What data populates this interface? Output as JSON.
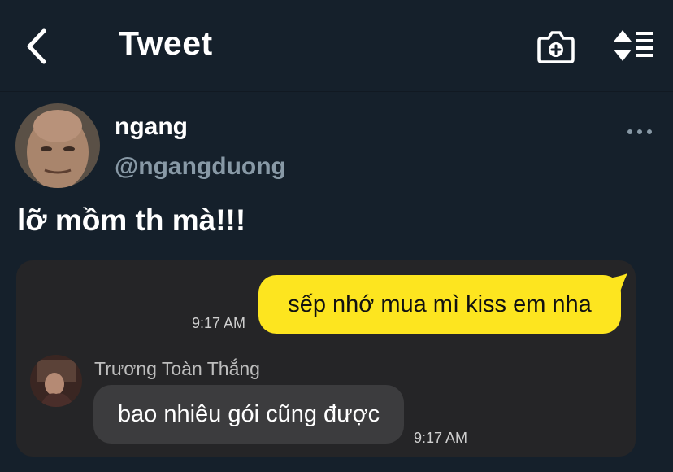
{
  "header": {
    "title": "Tweet",
    "back_icon": "chevron-left-icon",
    "camera_icon": "camera-plus-icon",
    "sort_icon": "sort-list-icon"
  },
  "tweet": {
    "display_name": "ngang",
    "handle": "@ngangduong",
    "text": "lỡ mồm th mà!!!",
    "more_icon": "more-horizontal-icon"
  },
  "chat": {
    "outgoing": {
      "text": "sếp nhớ mua mì kiss em nha",
      "time": "9:17 AM"
    },
    "incoming": {
      "sender": "Trương Toàn Thắng",
      "text": "bao nhiêu gói cũng được",
      "time": "9:17 AM"
    }
  },
  "colors": {
    "background": "#15202b",
    "handle": "#8899a6",
    "outgoing_bubble": "#fde51f",
    "incoming_bubble": "#3c3c3e",
    "media_bg": "#252527"
  }
}
